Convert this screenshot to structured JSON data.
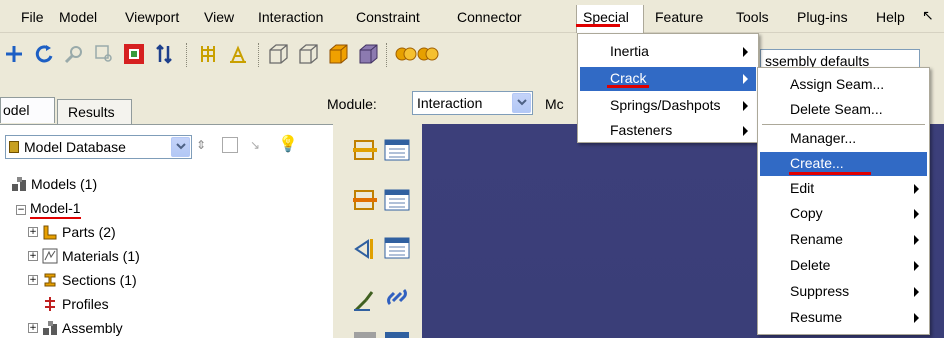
{
  "menubar": {
    "items": [
      {
        "label": "File"
      },
      {
        "label": "Model"
      },
      {
        "label": "Viewport"
      },
      {
        "label": "View"
      },
      {
        "label": "Interaction"
      },
      {
        "label": "Constraint"
      },
      {
        "label": "Connector"
      },
      {
        "label": "Special"
      },
      {
        "label": "Feature"
      },
      {
        "label": "Tools"
      },
      {
        "label": "Plug-ins"
      },
      {
        "label": "Help"
      }
    ]
  },
  "tabs": [
    {
      "label": "odel"
    },
    {
      "label": "Results"
    }
  ],
  "module": {
    "label": "Module:",
    "value": "Interaction",
    "next_fragment": "Mc"
  },
  "assembly_combo": {
    "value": "ssembly defaults"
  },
  "tree": {
    "database_select": "Model Database",
    "items": [
      {
        "label": "Models (1)"
      },
      {
        "label": "Model-1"
      },
      {
        "label": "Parts (2)"
      },
      {
        "label": "Materials (1)"
      },
      {
        "label": "Sections (1)"
      },
      {
        "label": "Profiles"
      },
      {
        "label": "Assembly"
      }
    ]
  },
  "special_menu": {
    "items": [
      {
        "label": "Inertia"
      },
      {
        "label": "Crack"
      },
      {
        "label": "Springs/Dashpots"
      },
      {
        "label": "Fasteners"
      }
    ],
    "highlighted": "Crack"
  },
  "crack_submenu": {
    "items": [
      {
        "label": "Assign Seam..."
      },
      {
        "label": "Delete Seam..."
      },
      {
        "label": "Manager..."
      },
      {
        "label": "Create..."
      },
      {
        "label": "Edit"
      },
      {
        "label": "Copy"
      },
      {
        "label": "Rename"
      },
      {
        "label": "Delete"
      },
      {
        "label": "Suppress"
      },
      {
        "label": "Resume"
      }
    ],
    "highlighted": "Create..."
  },
  "colors": {
    "highlight": "#316ac5",
    "annotation_red": "#e00000",
    "viewport": "#3c3f7a"
  }
}
